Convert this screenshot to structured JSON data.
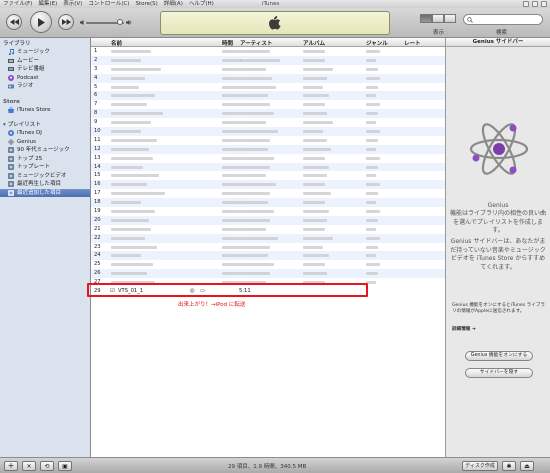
{
  "window": {
    "title": "iTunes",
    "menu": [
      "ファイル(F)",
      "編集(E)",
      "表示(V)",
      "コントロール(C)",
      "Store(S)",
      "詳細(A)",
      "ヘルプ(H)"
    ]
  },
  "toolbar": {
    "view_label": "表示",
    "search_label": "検索",
    "lcd_icon": "apple-logo"
  },
  "sidebar": {
    "library_header": "ライブラリ",
    "library_items": [
      {
        "label": "ミュージック",
        "icon": "music-icon"
      },
      {
        "label": "ムービー",
        "icon": "movie-icon"
      },
      {
        "label": "テレビ番組",
        "icon": "tv-icon"
      },
      {
        "label": "Podcast",
        "icon": "podcast-icon"
      },
      {
        "label": "ラジオ",
        "icon": "radio-icon"
      }
    ],
    "store_header": "Store",
    "store_items": [
      {
        "label": "iTunes Store",
        "icon": "store-icon"
      }
    ],
    "playlist_header": "プレイリスト",
    "playlist_items": [
      {
        "label": "iTunes DJ",
        "icon": "dj-icon"
      },
      {
        "label": "Genius",
        "icon": "genius-icon"
      },
      {
        "label": "90 年代ミュージック",
        "icon": "smart-playlist-icon"
      },
      {
        "label": "トップ 25",
        "icon": "smart-playlist-icon"
      },
      {
        "label": "トップレート",
        "icon": "smart-playlist-icon"
      },
      {
        "label": "ミュージックビデオ",
        "icon": "smart-playlist-icon"
      },
      {
        "label": "最近再生した項目",
        "icon": "smart-playlist-icon"
      },
      {
        "label": "最近追加した項目",
        "icon": "smart-playlist-icon",
        "selected": true
      }
    ]
  },
  "tracklist": {
    "columns": [
      "名前",
      "時間",
      "アーティスト",
      "アルバム",
      "ジャンル",
      "レート"
    ],
    "row_numbers": [
      "1",
      "2",
      "3",
      "4",
      "5",
      "6",
      "7",
      "8",
      "9",
      "10",
      "11",
      "12",
      "13",
      "14",
      "15",
      "16",
      "17",
      "18",
      "19",
      "20",
      "21",
      "22",
      "23",
      "24",
      "25",
      "26",
      "27",
      "28"
    ],
    "highlighted_row": {
      "number": "29",
      "name": "VTS_01_1",
      "time": "5:11",
      "checked": true
    },
    "annotation": "出来上がり！→iPod に転送"
  },
  "genius": {
    "header": "Genius サイドバー",
    "title": "Genius",
    "desc1": "機能はライブラリ内の相性の良い曲を選んでプレイリストを作成します。",
    "desc2": "Genius サイドバーは、あなたがまだ持っていない音楽やミュージックビデオを iTunes Store からすすめてくれます。",
    "note": "Genius 機能をオンにするとiTunes ライブラリの情報がAppleに送信されます。",
    "details_link": "詳細情報",
    "turn_on_button": "Genius 機能をオンにする",
    "hide_button": "サイドバーを隠す"
  },
  "statusbar": {
    "summary": "29 項目、1.9 時間、340.5 MB",
    "burn_button": "ディスク作成"
  }
}
